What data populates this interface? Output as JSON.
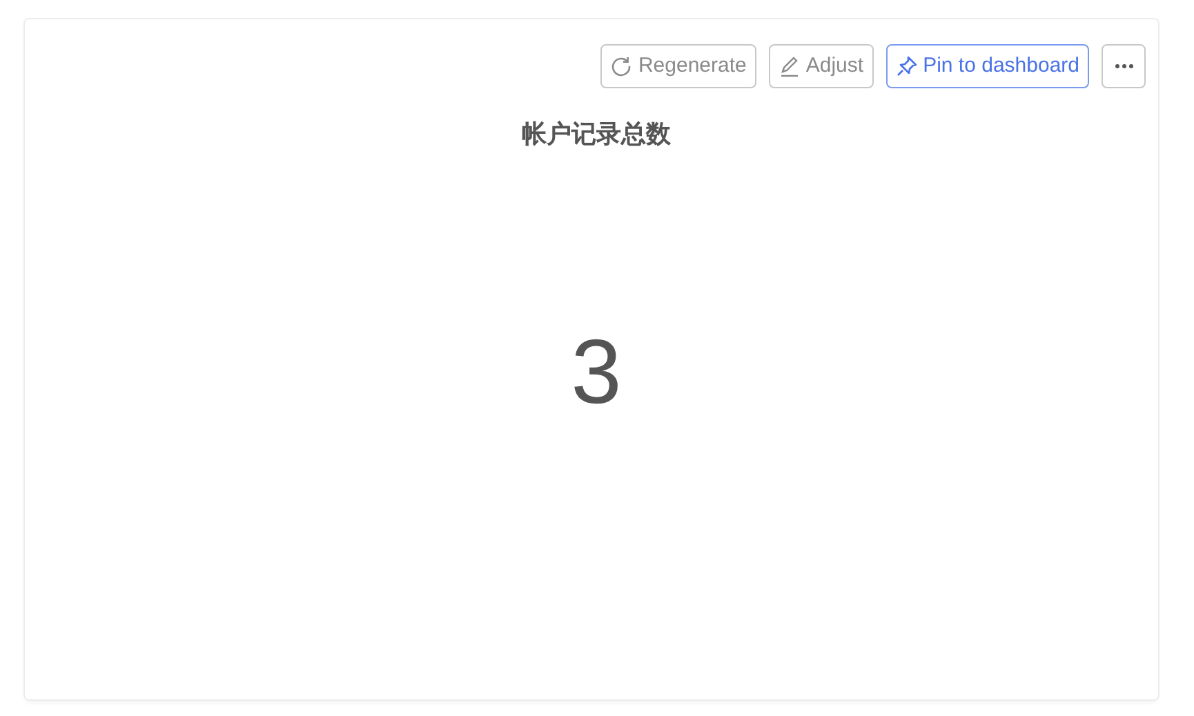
{
  "toolbar": [
    {
      "kind": "regenerate",
      "label": "Regenerate"
    },
    {
      "kind": "adjust",
      "label": "Adjust"
    },
    {
      "kind": "pin",
      "label": "Pin to dashboard"
    },
    {
      "kind": "more"
    }
  ],
  "title": "帐户记录总数",
  "value": "3"
}
